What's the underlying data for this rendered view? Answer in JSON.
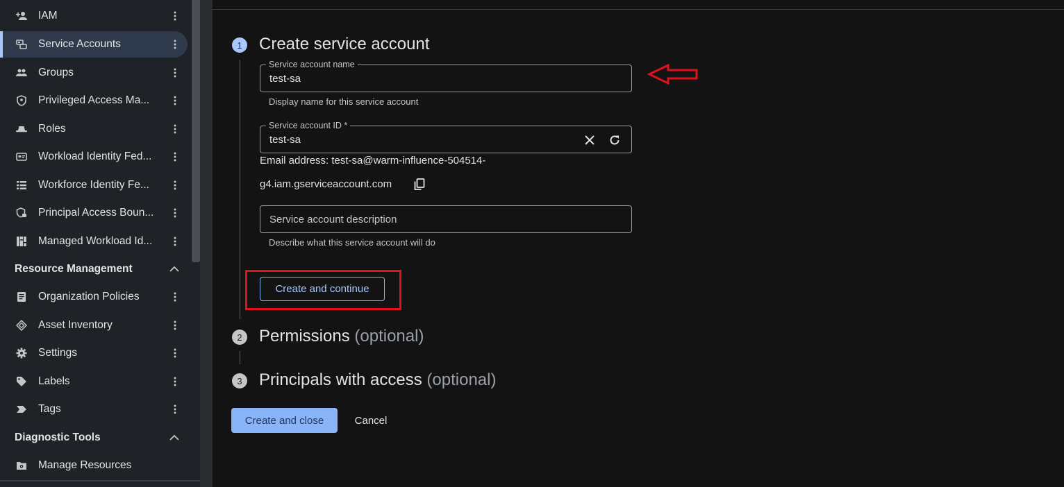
{
  "sidebar": {
    "items": [
      {
        "label": "IAM",
        "icon": "person-add-icon"
      },
      {
        "label": "Service Accounts",
        "icon": "service-account-icon",
        "active": true
      },
      {
        "label": "Groups",
        "icon": "groups-icon"
      },
      {
        "label": "Privileged Access Ma...",
        "icon": "shield-icon"
      },
      {
        "label": "Roles",
        "icon": "hat-icon"
      },
      {
        "label": "Workload Identity Fed...",
        "icon": "id-card-icon"
      },
      {
        "label": "Workforce Identity Fe...",
        "icon": "list-icon"
      },
      {
        "label": "Principal Access Boun...",
        "icon": "shield-lock-icon"
      },
      {
        "label": "Managed Workload Id...",
        "icon": "grid-icon"
      }
    ],
    "section_resource": "Resource Management",
    "resource_items": [
      {
        "label": "Organization Policies",
        "icon": "document-icon"
      },
      {
        "label": "Asset Inventory",
        "icon": "diamond-icon"
      },
      {
        "label": "Settings",
        "icon": "gear-icon"
      },
      {
        "label": "Labels",
        "icon": "tag-icon"
      },
      {
        "label": "Tags",
        "icon": "chevron-tag-icon"
      }
    ],
    "section_diagnostic": "Diagnostic Tools",
    "diagnostic_items": [
      {
        "label": "Manage Resources",
        "icon": "folder-gear-icon"
      }
    ]
  },
  "steps": [
    {
      "number": "1",
      "title": "Create service account",
      "optional": ""
    },
    {
      "number": "2",
      "title": "Permissions",
      "optional": "(optional)"
    },
    {
      "number": "3",
      "title": "Principals with access",
      "optional": "(optional)"
    }
  ],
  "form": {
    "name_label": "Service account name",
    "name_value": "test-sa",
    "name_hint": "Display name for this service account",
    "id_label": "Service account ID *",
    "id_value": "test-sa",
    "email_line1": "Email address: test-sa@warm-influence-504514-",
    "email_line2": "g4.iam.gserviceaccount.com",
    "description_placeholder": "Service account description",
    "description_hint": "Describe what this service account will do",
    "create_continue": "Create and continue"
  },
  "footer": {
    "create_close": "Create and close",
    "cancel": "Cancel"
  },
  "colors": {
    "accent": "#a8c7fa",
    "annotation": "#e0111b"
  }
}
